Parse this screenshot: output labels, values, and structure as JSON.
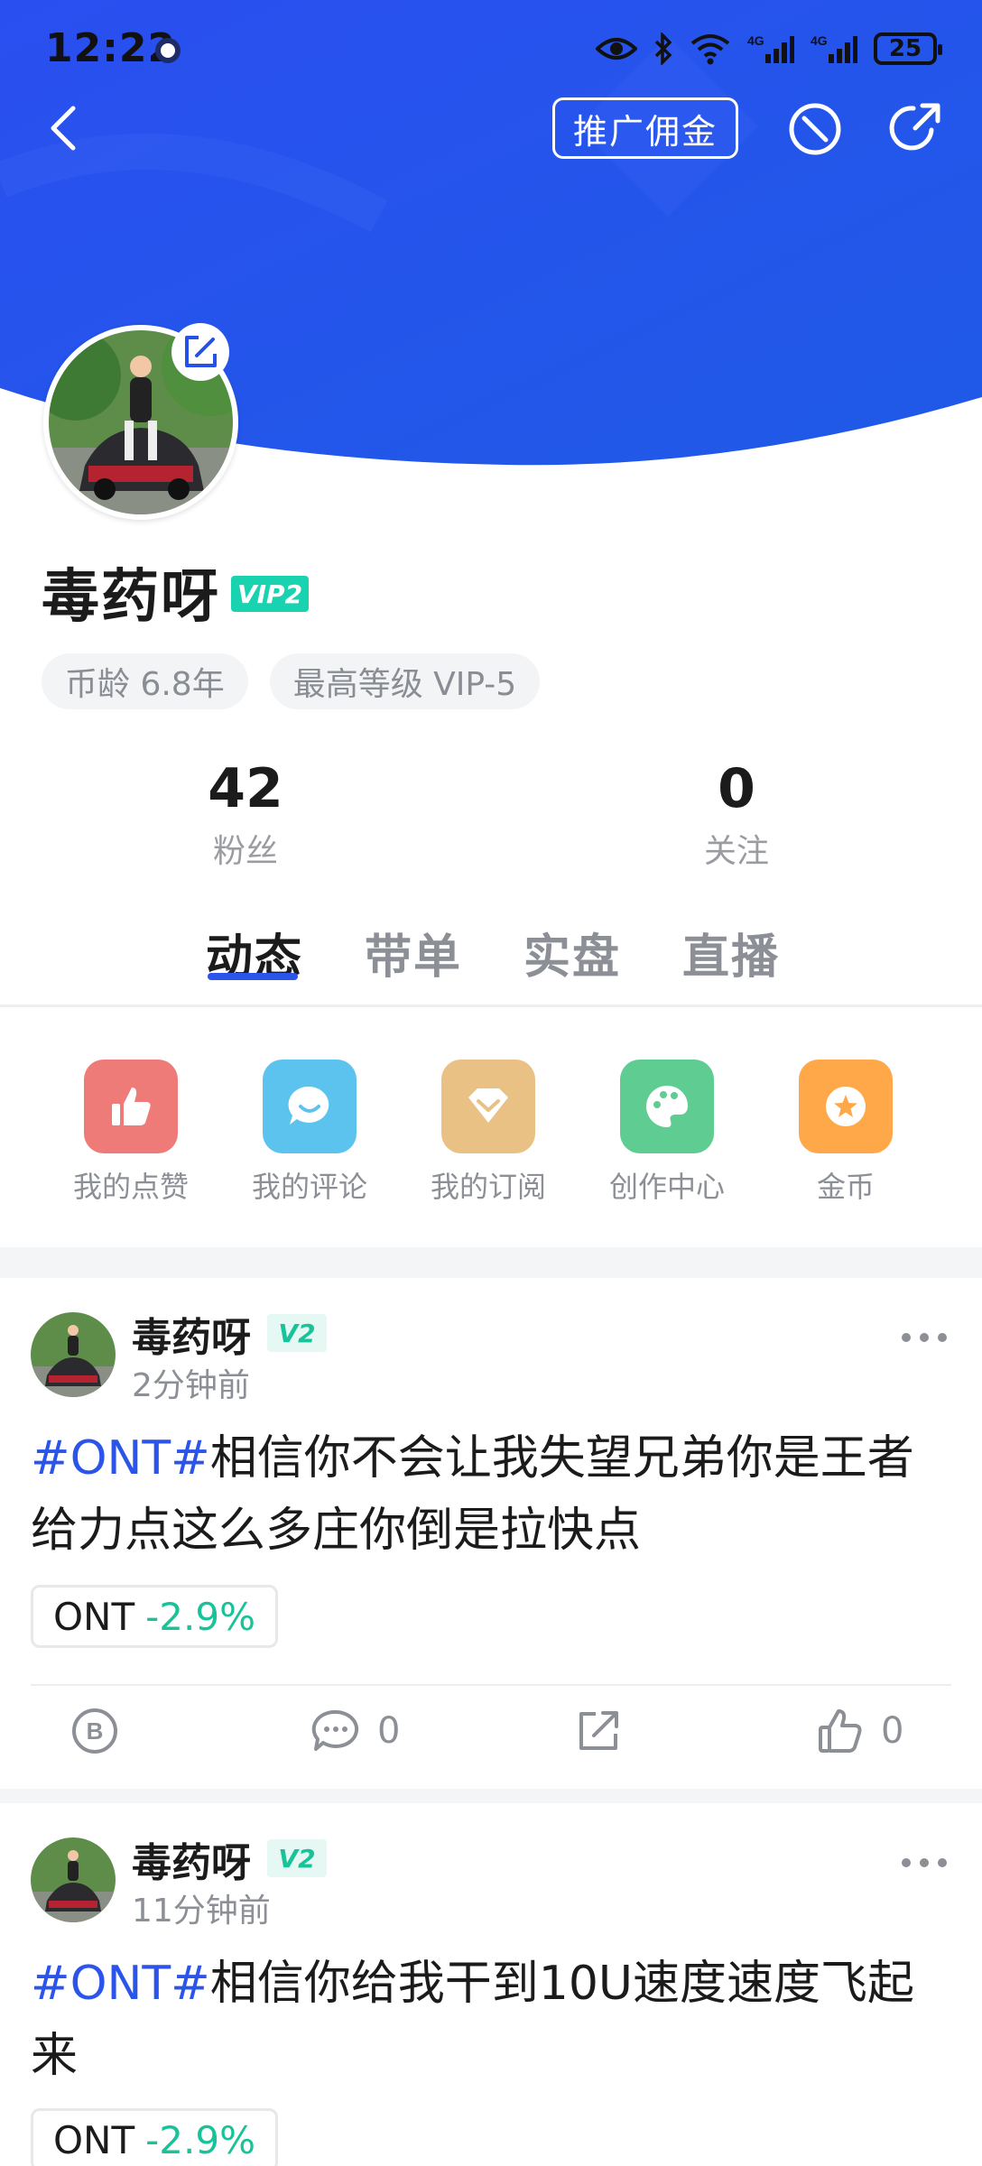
{
  "status_bar": {
    "time": "12:22",
    "battery": "25"
  },
  "header": {
    "promo_label": "推广佣金",
    "colors": {
      "brand_blue": "#2452e9",
      "accent_green": "#19c39a"
    }
  },
  "profile": {
    "name": "毒药呀",
    "vip_badge": "VIP2",
    "chips": [
      "币龄 6.8年",
      "最高等级 VIP-5"
    ],
    "stats": [
      {
        "value": "42",
        "label": "粉丝"
      },
      {
        "value": "0",
        "label": "关注"
      }
    ]
  },
  "tabs": [
    {
      "label": "动态",
      "active": true
    },
    {
      "label": "带单",
      "active": false
    },
    {
      "label": "实盘",
      "active": false
    },
    {
      "label": "直播",
      "active": false
    }
  ],
  "quick_actions": [
    {
      "label": "我的点赞",
      "icon": "thumbs-up-icon",
      "color": "#ef7b78"
    },
    {
      "label": "我的评论",
      "icon": "chat-bubble-icon",
      "color": "#5cc3ef"
    },
    {
      "label": "我的订阅",
      "icon": "diamond-icon",
      "color": "#e9c185"
    },
    {
      "label": "创作中心",
      "icon": "palette-icon",
      "color": "#5fcc92"
    },
    {
      "label": "金币",
      "icon": "star-coin-icon",
      "color": "#ffa84a"
    }
  ],
  "posts": [
    {
      "author": "毒药呀",
      "level": "V2",
      "time": "2分钟前",
      "tag": "#ONT#",
      "text": "相信你不会让我失望兄弟你是王者给力点这么多庄你倒是拉快点",
      "coin": "ONT",
      "change": "-2.9%",
      "comments": "0",
      "likes": "0"
    },
    {
      "author": "毒药呀",
      "level": "V2",
      "time": "11分钟前",
      "tag": "#ONT#",
      "text": "相信你给我干到10U速度速度飞起来",
      "coin": "ONT",
      "change": "-2.9%"
    }
  ]
}
